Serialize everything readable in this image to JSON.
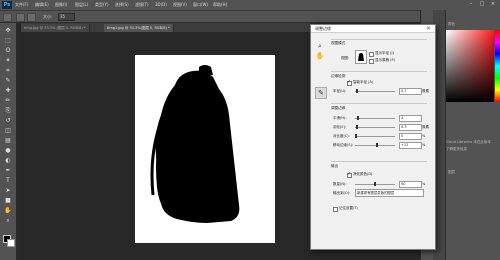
{
  "app": {
    "logo": "Ps"
  },
  "menubar": {
    "items": [
      "文件(F)",
      "编辑(E)",
      "图像(I)",
      "图层(L)",
      "类型(Y)",
      "选择(S)",
      "滤镜(T)",
      "3D(D)",
      "视图(V)",
      "窗口(W)",
      "帮助(H)"
    ],
    "window_buttons": [
      "–",
      "□",
      "×"
    ]
  },
  "options": {
    "size_label": "大小:",
    "size_value": "35"
  },
  "tabs": [
    {
      "label": "timg.jpg @ 33.3% (图层 0, RGB/8) *",
      "active": false
    },
    {
      "label": "timg1.jpg @ 33.3%(图层 0, RGB/8) *",
      "active": true
    }
  ],
  "toolbar": {
    "icons": [
      "move-icon",
      "marquee-icon",
      "lasso-icon",
      "magic-wand-icon",
      "crop-icon",
      "eyedropper-icon",
      "healing-icon",
      "brush-icon",
      "stamp-icon",
      "history-brush-icon",
      "eraser-icon",
      "gradient-icon",
      "blur-icon",
      "dodge-icon",
      "pen-icon",
      "type-icon",
      "path-select-icon",
      "shape-icon",
      "hand-icon",
      "zoom-icon"
    ],
    "glyphs": [
      "✥",
      "⬚",
      "ʘ",
      "✶",
      "⌗",
      "✎",
      "✚",
      "✏",
      "⎘",
      "↺",
      "◫",
      "▤",
      "●",
      "◐",
      "✒",
      "T",
      "➤",
      "■",
      "✋",
      "⌕"
    ]
  },
  "colors": {
    "foreground": "#000000",
    "background": "#ffffff",
    "accent": "#5fb7f7"
  },
  "dialog": {
    "title": "调整边缘",
    "close": "×",
    "view_mode": {
      "heading": "视图模式",
      "view_label": "视图:",
      "show_radius": "显示半径 (J)",
      "show_original": "显示原稿 (P)"
    },
    "edge_detection": {
      "heading": "边缘检测",
      "smart_radius": "智能半径 (A)",
      "radius_label": "半径(U):",
      "radius_value": "0.7",
      "radius_unit": "像素"
    },
    "adjust_edge": {
      "heading": "调整边缘",
      "rows": [
        {
          "label": "平滑(H):",
          "value": "4",
          "unit": "",
          "level": 0.04
        },
        {
          "label": "羽化(E):",
          "value": "0.3",
          "unit": "像素",
          "level": 0.02
        },
        {
          "label": "对比度(C):",
          "value": "0",
          "unit": "%",
          "level": 0.0
        },
        {
          "label": "移动边缘(S):",
          "value": "+12",
          "unit": "%",
          "level": 0.56
        }
      ]
    },
    "output": {
      "heading": "输出",
      "decontaminate": "净化颜色(D)",
      "amount_label": "数量(N):",
      "amount_value": "50",
      "amount_unit": "%",
      "amount_level": 0.5,
      "output_to_label": "输出到(O):",
      "output_to_value": "新建带有图层蒙版的图层"
    },
    "remember": "记住设置(T)"
  },
  "panels": {
    "tab_label": "颜色",
    "lib_text": "Cloud Libraries 未在此版本",
    "title_text": "了解更多信息",
    "layers_label": "图层"
  }
}
